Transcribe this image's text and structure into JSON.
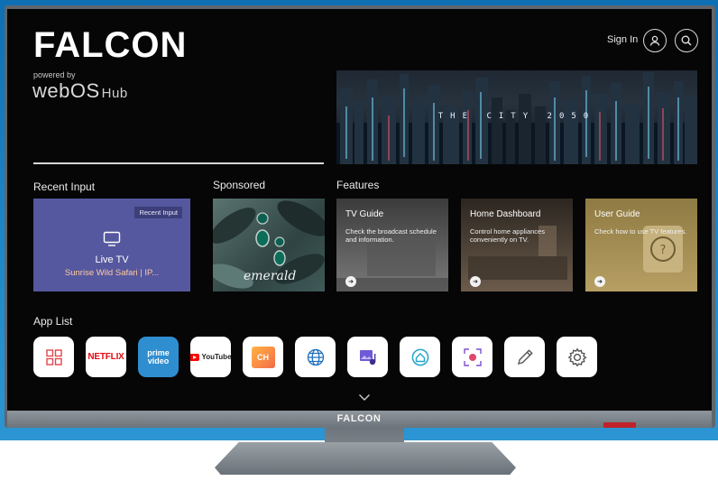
{
  "header": {
    "brand": "FALCON",
    "powered_by": "powered by",
    "platform": "webOS",
    "platform_suffix": "Hub",
    "sign_in": "Sign In"
  },
  "hero": {
    "title": "THE CITY 2050"
  },
  "sections": {
    "recent_input": "Recent Input",
    "sponsored": "Sponsored",
    "features": "Features",
    "app_list": "App List"
  },
  "recent_input_card": {
    "tag": "Recent Input",
    "title": "Live TV",
    "subtitle": "Sunrise Wild Safari | IP..."
  },
  "sponsored_card": {
    "text": "emerald"
  },
  "feature_cards": [
    {
      "title": "TV Guide",
      "desc": "Check the broadcast schedule and information."
    },
    {
      "title": "Home Dashboard",
      "desc": "Control home appliances conveniently on TV."
    },
    {
      "title": "User Guide",
      "desc": "Check how to use TV features."
    }
  ],
  "apps": [
    {
      "name": "apps-icon"
    },
    {
      "name": "netflix",
      "label": "NETFLIX"
    },
    {
      "name": "prime-video",
      "label": "prime video"
    },
    {
      "name": "youtube",
      "label": "YouTube"
    },
    {
      "name": "channels-icon",
      "label": "CH"
    },
    {
      "name": "browser-icon"
    },
    {
      "name": "gallery-icon"
    },
    {
      "name": "home-dashboard-icon"
    },
    {
      "name": "screen-capture-icon"
    },
    {
      "name": "edit-icon"
    },
    {
      "name": "settings-icon"
    }
  ],
  "tv_chin": {
    "brand": "FALCON"
  },
  "colors": {
    "recent_input_card": "#55589e",
    "prime_video": "#2f8ecf",
    "netflix": "#e50914",
    "subtitle_accent": "#ffc9a3"
  }
}
